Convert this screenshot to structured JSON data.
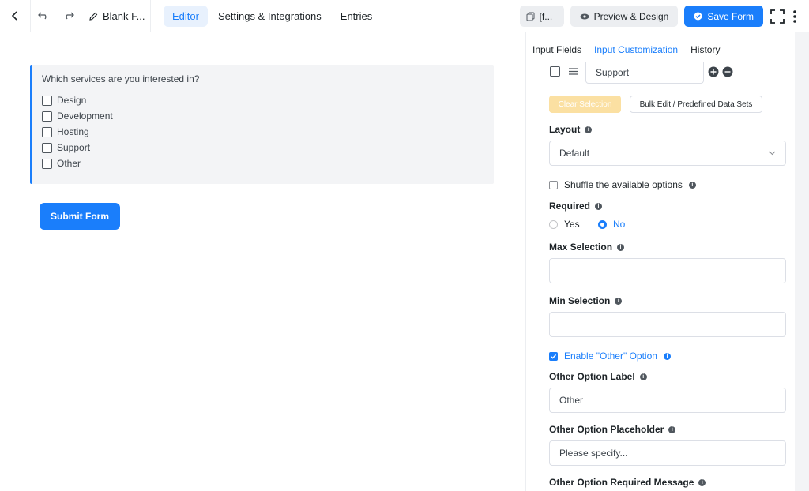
{
  "topbar": {
    "form_title": "Blank F...",
    "nav": [
      "Editor",
      "Settings & Integrations",
      "Entries"
    ],
    "shortcode_label": "[f...",
    "preview_label": "Preview & Design",
    "save_label": "Save Form"
  },
  "form": {
    "question": "Which services are you interested in?",
    "options": [
      "Design",
      "Development",
      "Hosting",
      "Support",
      "Other"
    ],
    "submit_label": "Submit Form"
  },
  "panel": {
    "tabs": [
      "Input Fields",
      "Input Customization",
      "History"
    ],
    "option_value": "Support",
    "clear_selection": "Clear Selection",
    "bulk_edit": "Bulk Edit / Predefined Data Sets",
    "layout_label": "Layout",
    "layout_value": "Default",
    "shuffle_label": "Shuffle the available options",
    "required_label": "Required",
    "required_yes": "Yes",
    "required_no": "No",
    "max_selection_label": "Max Selection",
    "min_selection_label": "Min Selection",
    "enable_other_label": "Enable \"Other\" Option",
    "other_label_label": "Other Option Label",
    "other_label_value": "Other",
    "other_placeholder_label": "Other Option Placeholder",
    "other_placeholder_value": "Please specify...",
    "other_required_label": "Other Option Required Message"
  },
  "colors": {
    "accent": "#1a7efb",
    "clear_btn": "#fbe0a2"
  }
}
